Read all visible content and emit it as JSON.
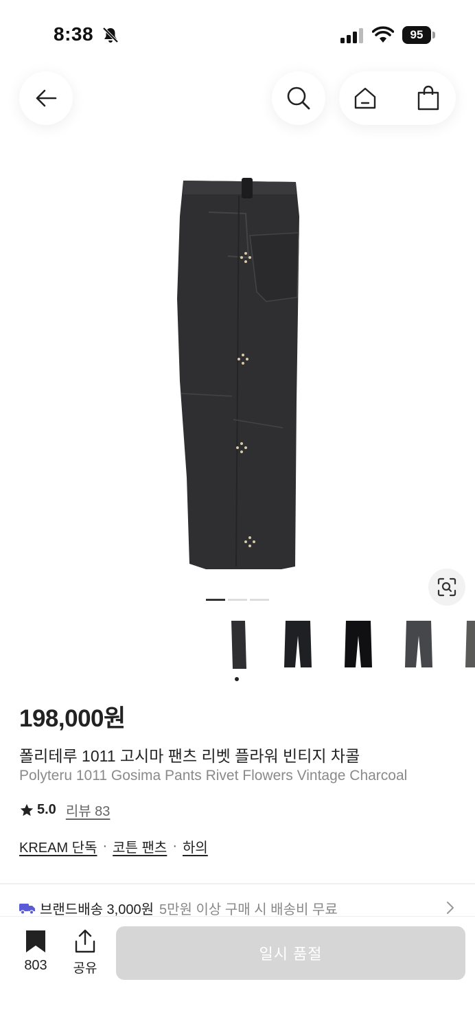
{
  "status_bar": {
    "time": "8:38",
    "battery": "95"
  },
  "product": {
    "price": "198,000원",
    "name_ko": "폴리테루 1011 고시마 팬츠 리벳 플라워 빈티지 차콜",
    "name_en": "Polyteru 1011 Gosima Pants Rivet Flowers Vintage Charcoal",
    "rating": "5.0",
    "review_link": "리뷰 83",
    "tags": [
      "KREAM 단독",
      "코튼 팬츠",
      "하의"
    ],
    "tag_separator": "·",
    "image_pager": {
      "pages": 3,
      "current": 1
    }
  },
  "shipping": {
    "label": "브랜드배송 3,000원",
    "note": "5만원 이상 구매 시 배송비 무료"
  },
  "bottom_bar": {
    "save_count": "803",
    "share_label": "공유",
    "action_label": "일시 품절"
  },
  "icons": [
    "back-arrow-icon",
    "search-icon",
    "home-icon",
    "shopping-bag-icon",
    "lens-search-icon",
    "star-icon",
    "truck-icon",
    "chevron-right-icon",
    "bookmark-icon",
    "share-icon",
    "bell-slash-icon",
    "signal-icon",
    "wifi-icon",
    "battery-icon"
  ],
  "colors": {
    "accent_truck": "#5b5bd6",
    "soldout_button": "#d6d6d6",
    "text_primary": "#222222",
    "text_secondary": "#8a8a8a"
  }
}
